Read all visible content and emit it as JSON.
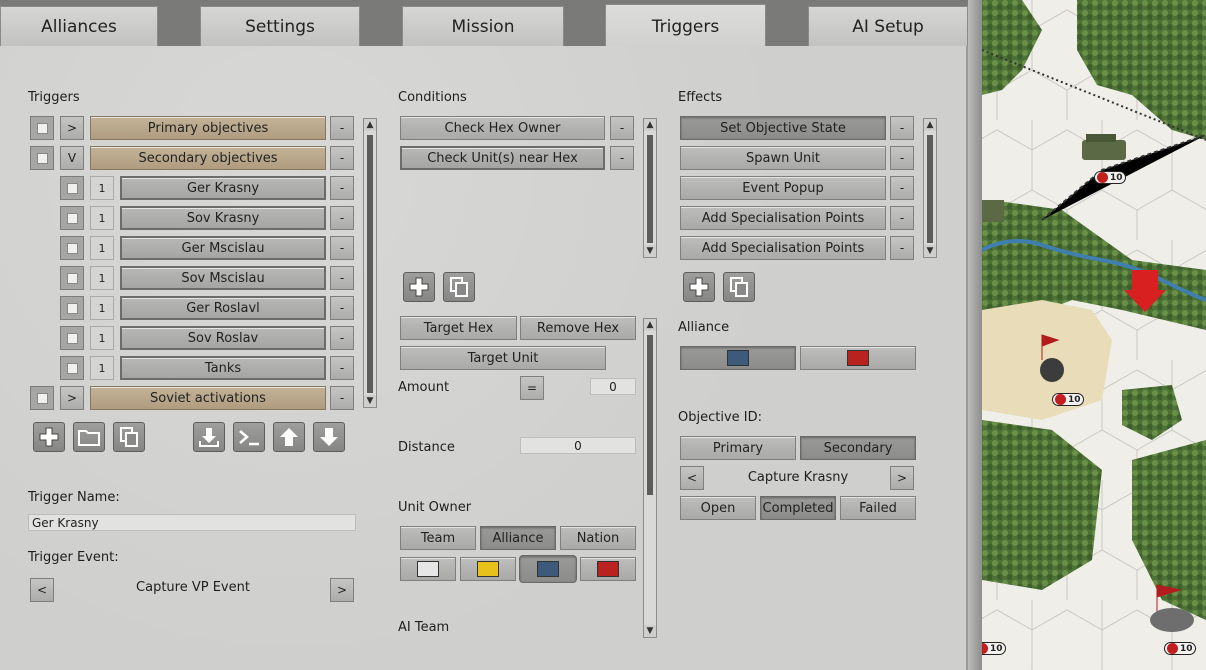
{
  "tabs": [
    "Alliances",
    "Settings",
    "Mission",
    "Triggers",
    "AI Setup"
  ],
  "triggers": {
    "heading": "Triggers",
    "rows": [
      {
        "expand": ">",
        "label": "Primary objectives",
        "kind": "group"
      },
      {
        "expand": "V",
        "label": "Secondary objectives",
        "kind": "group"
      },
      {
        "num": "1",
        "label": "Ger Krasny",
        "kind": "item"
      },
      {
        "num": "1",
        "label": "Sov Krasny",
        "kind": "item"
      },
      {
        "num": "1",
        "label": "Ger Mscislau",
        "kind": "item"
      },
      {
        "num": "1",
        "label": "Sov Mscislau",
        "kind": "item"
      },
      {
        "num": "1",
        "label": "Ger Roslavl",
        "kind": "item"
      },
      {
        "num": "1",
        "label": "Sov Roslav",
        "kind": "item"
      },
      {
        "num": "1",
        "label": "Tanks",
        "kind": "item"
      },
      {
        "expand": ">",
        "label": "Soviet activations",
        "kind": "group"
      }
    ],
    "remove_label": "-",
    "trigger_name_label": "Trigger Name:",
    "trigger_name_value": "Ger Krasny",
    "trigger_event_label": "Trigger Event:",
    "trigger_event_value": "Capture VP Event",
    "prev": "<",
    "next": ">"
  },
  "conditions": {
    "heading": "Conditions",
    "items": [
      "Check Hex Owner",
      "Check Unit(s) near Hex"
    ],
    "target_hex": "Target Hex",
    "remove_hex": "Remove Hex",
    "target_unit": "Target Unit",
    "amount_label": "Amount",
    "amount_op": "=",
    "amount_value": "0",
    "distance_label": "Distance",
    "distance_value": "0",
    "unit_owner_label": "Unit Owner",
    "owner_buttons": [
      "Team",
      "Alliance",
      "Nation"
    ],
    "ai_team_label": "AI Team"
  },
  "effects": {
    "heading": "Effects",
    "items": [
      "Set Objective State",
      "Spawn Unit",
      "Event Popup",
      "Add Specialisation Points",
      "Add Specialisation Points"
    ],
    "alliance_label": "Alliance",
    "objective_id_label": "Objective ID:",
    "primary": "Primary",
    "secondary": "Secondary",
    "objective_value": "Capture Krasny",
    "states": [
      "Open",
      "Completed",
      "Failed"
    ]
  },
  "colors": {
    "white": "#e6e6e6",
    "yellow": "#e8c21a",
    "blue": "#3e5a7a",
    "red": "#b8231f"
  },
  "map": {
    "unit_strengths": [
      "10",
      "10",
      "10",
      "10"
    ]
  }
}
